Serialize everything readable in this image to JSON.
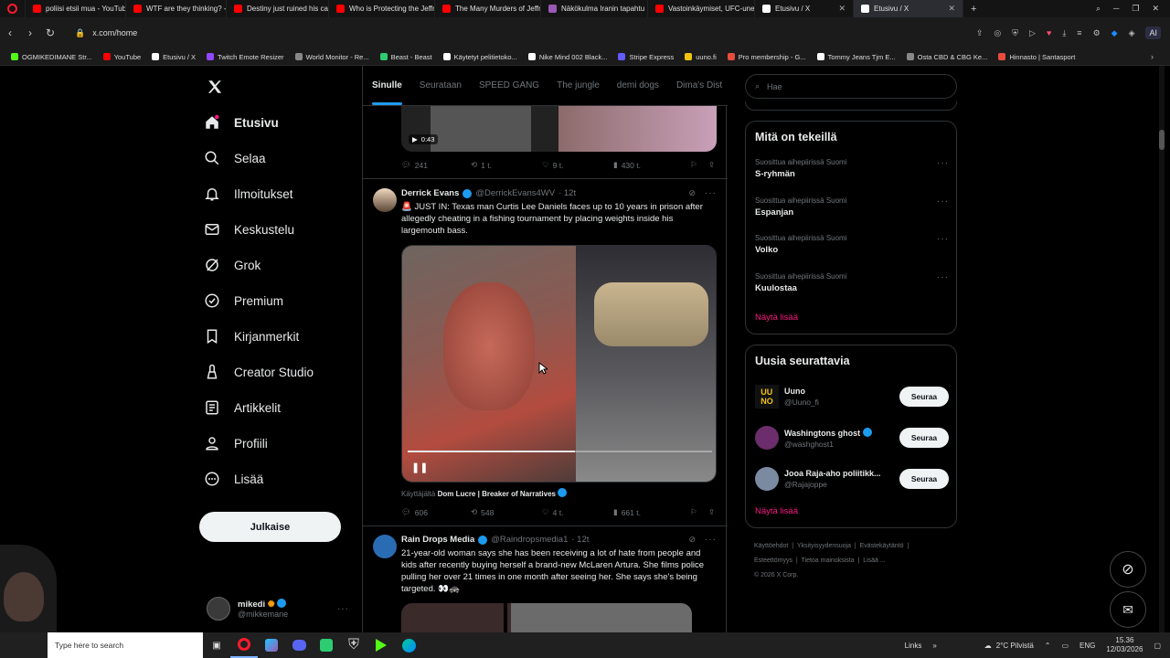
{
  "browser": {
    "tabs": [
      {
        "title": "poliisi etsii mua - YouTube",
        "color": "#ff0000"
      },
      {
        "title": "WTF are they thinking? - Y",
        "color": "#ff0000"
      },
      {
        "title": "Destiny just ruined his car",
        "color": "#ff0000"
      },
      {
        "title": "Who is Protecting the Jeffr",
        "color": "#ff0000"
      },
      {
        "title": "The Many Murders of Jeffr",
        "color": "#ff0000"
      },
      {
        "title": "Näkökulma Iranin tapahtu",
        "color": "#9b59b6"
      },
      {
        "title": "Vastoinkäymiset, UFC-une",
        "color": "#ff0000"
      },
      {
        "title": "Etusivu / X",
        "color": "#ffffff"
      },
      {
        "title": "Etusivu / X",
        "color": "#ffffff"
      }
    ],
    "url": "x.com/home",
    "ai_label": "AI",
    "bookmarks": [
      {
        "label": "OGMIKEDIMANE Str...",
        "color": "#53fc18"
      },
      {
        "label": "YouTube",
        "color": "#ff0000"
      },
      {
        "label": "Etusivu / X",
        "color": "#ffffff"
      },
      {
        "label": "Twitch Emote Resizer",
        "color": "#9146ff"
      },
      {
        "label": "World Monitor - Re...",
        "color": "#888888"
      },
      {
        "label": "Beast - Beast",
        "color": "#2ecc71"
      },
      {
        "label": "Käytetyt pelitietoko...",
        "color": "#ffffff"
      },
      {
        "label": "Nike Mind 002 Black...",
        "color": "#ffffff"
      },
      {
        "label": "Stripe Express",
        "color": "#635bff"
      },
      {
        "label": "uuno.fi",
        "color": "#f1c40f"
      },
      {
        "label": "Pro membership - G...",
        "color": "#e74c3c"
      },
      {
        "label": "Tommy Jeans Tjm E...",
        "color": "#ffffff"
      },
      {
        "label": "Osta CBD & CBG Ke...",
        "color": "#888888"
      },
      {
        "label": "Hinnasto | Santasport",
        "color": "#e74c3c"
      }
    ]
  },
  "sidebar": {
    "items": [
      {
        "label": "Etusivu",
        "icon": "home-icon"
      },
      {
        "label": "Selaa",
        "icon": "search-icon"
      },
      {
        "label": "Ilmoitukset",
        "icon": "bell-icon"
      },
      {
        "label": "Keskustelu",
        "icon": "mail-icon"
      },
      {
        "label": "Grok",
        "icon": "grok-icon"
      },
      {
        "label": "Premium",
        "icon": "premium-icon"
      },
      {
        "label": "Kirjanmerkit",
        "icon": "bookmark-icon"
      },
      {
        "label": "Creator Studio",
        "icon": "creator-icon"
      },
      {
        "label": "Artikkelit",
        "icon": "article-icon"
      },
      {
        "label": "Profiili",
        "icon": "profile-icon"
      },
      {
        "label": "Lisää",
        "icon": "more-icon"
      }
    ],
    "post_button": "Julkaise",
    "account": {
      "name": "mikedi",
      "handle": "@mikkemane"
    }
  },
  "feed": {
    "tabs": [
      "Sinulle",
      "Seurataan",
      "SPEED GANG",
      "The jungle",
      "demi dogs",
      "Dima's Dist"
    ],
    "prev_tweet": {
      "duration": "0:43",
      "replies": "241",
      "retweets": "1 t.",
      "likes": "9 t.",
      "views": "430 t."
    },
    "tweets": [
      {
        "name": "Derrick Evans",
        "handle": "@DerrickEvans4WV",
        "time": "· 12t",
        "text": "🚨 JUST IN: Texas man Curtis Lee Daniels faces up to 10 years in prison after allegedly cheating in a fishing tournament by placing weights inside his largemouth bass.",
        "from_prefix": "Käyttäjältä",
        "from_name": "Dom Lucre | Breaker of Narratives",
        "replies": "606",
        "retweets": "548",
        "likes": "4 t.",
        "views": "661 t."
      },
      {
        "name": "Rain Drops Media",
        "handle": "@Raindropsmedia1",
        "time": "· 12t",
        "text": "21-year-old woman says she has been receiving a lot of hate from people and kids after recently buying herself a brand-new McLaren Artura. She films police pulling her over 21 times in one month after seeing her. She says she's being targeted. 👀🚓"
      }
    ]
  },
  "right": {
    "search_placeholder": "Hae",
    "trends_title": "Mitä on tekeillä",
    "trends": [
      {
        "sub": "Suosittua aihepiirissä Suomi",
        "name": "S-ryhmän"
      },
      {
        "sub": "Suosittua aihepiirissä Suomi",
        "name": "Espanjan"
      },
      {
        "sub": "Suosittua aihepiirissä Suomi",
        "name": "Volko"
      },
      {
        "sub": "Suosittua aihepiirissä Suomi",
        "name": "Kuulostaa"
      }
    ],
    "show_more": "Näytä lisää",
    "follow_title": "Uusia seurattavia",
    "follow": [
      {
        "name": "Uuno",
        "handle": "@Uuno_fi"
      },
      {
        "name": "Washingtons ghost",
        "handle": "@washghost1"
      },
      {
        "name": "Jooa Raja-aho poliitikk...",
        "handle": "@Rajajoppe"
      }
    ],
    "follow_button": "Seuraa",
    "footer": [
      "Käyttöehdot",
      "Yksityisyydensuoja",
      "Evästekäytäntö",
      "Esteettömyys",
      "Tietoa mainoksista",
      "Lisää ...",
      "© 2026 X Corp."
    ]
  },
  "taskbar": {
    "search_placeholder": "Type here to search",
    "links": "Links",
    "weather": "2°C  Pilvistä",
    "lang": "ENG",
    "time": "15.36",
    "date": "12/03/2026"
  }
}
